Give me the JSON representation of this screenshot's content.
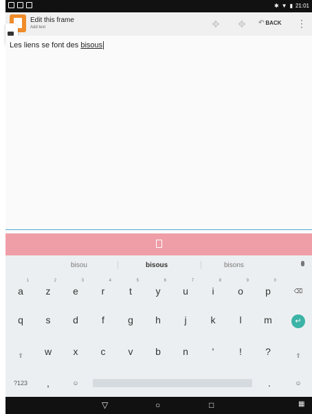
{
  "status": {
    "time": "21:01"
  },
  "appbar": {
    "title": "Edit this frame",
    "subtitle": "Add text",
    "back_label": "BACK"
  },
  "editor": {
    "text_prefix": "Les liens se font des ",
    "text_word": "bisous"
  },
  "suggestions": [
    "bisou",
    "bisous",
    "bisons"
  ],
  "keyboard": {
    "row1": [
      {
        "k": "a",
        "n": "1"
      },
      {
        "k": "z",
        "n": "2"
      },
      {
        "k": "e",
        "n": "3"
      },
      {
        "k": "r",
        "n": "4"
      },
      {
        "k": "t",
        "n": "5"
      },
      {
        "k": "y",
        "n": "6"
      },
      {
        "k": "u",
        "n": "7"
      },
      {
        "k": "i",
        "n": "8"
      },
      {
        "k": "o",
        "n": "9"
      },
      {
        "k": "p",
        "n": "0"
      }
    ],
    "row2": [
      "q",
      "s",
      "d",
      "f",
      "g",
      "h",
      "j",
      "k",
      "l",
      "m"
    ],
    "row3": [
      "w",
      "x",
      "c",
      "v",
      "b",
      "n",
      "'",
      "!",
      "?"
    ],
    "mode_label": "?123",
    "comma": ",",
    "period": "."
  },
  "colors": {
    "accent": "#3bb3a6",
    "pink": "#ef9ea7",
    "app_icon": "#f08c2a"
  }
}
